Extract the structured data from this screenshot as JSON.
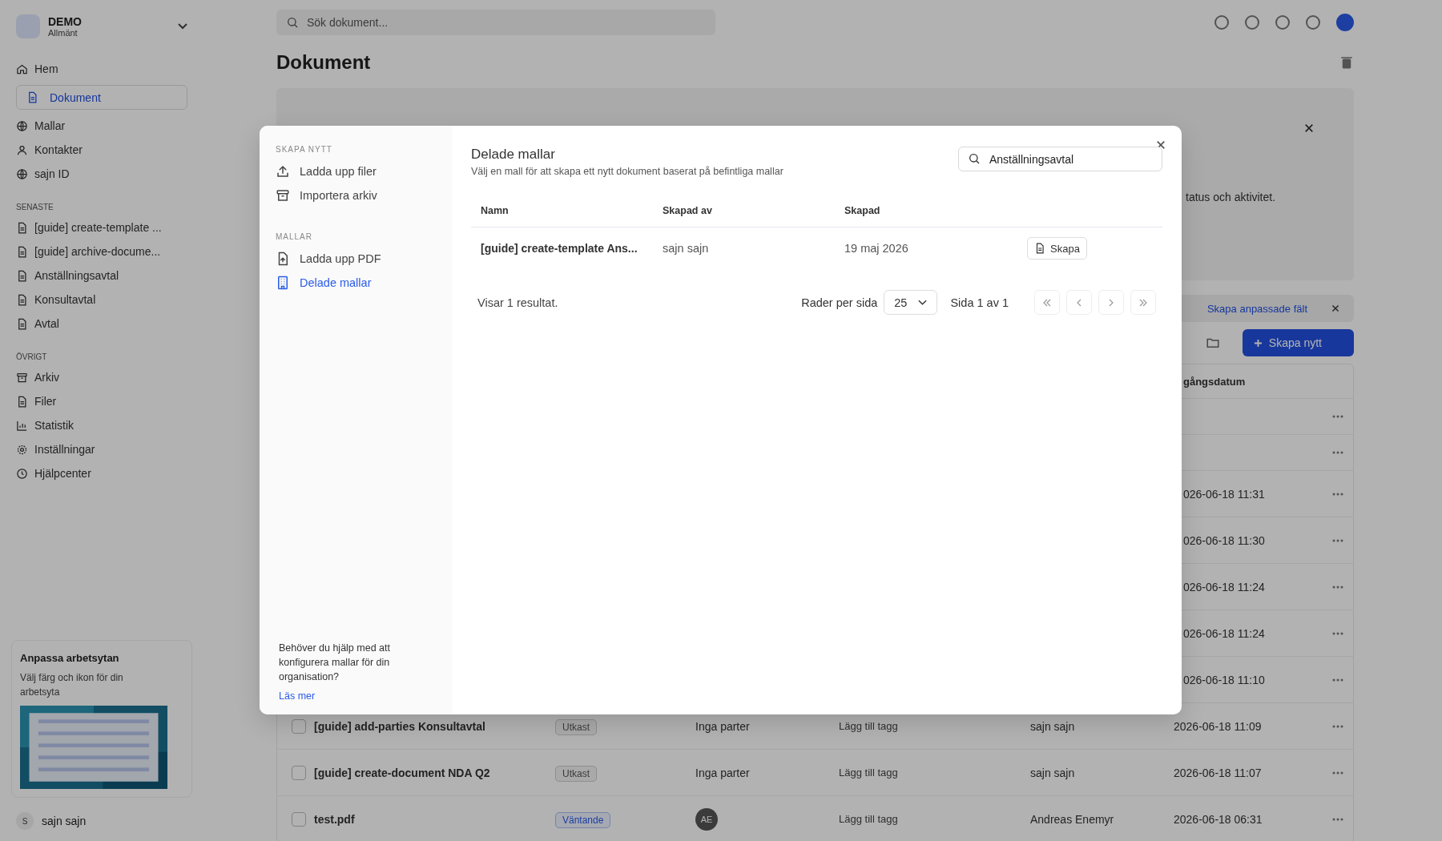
{
  "sidebar": {
    "org": {
      "name": "DEMO",
      "subtitle": "Allmänt"
    },
    "nav": [
      {
        "label": "Hem",
        "selected": false
      },
      {
        "label": "Dokument",
        "selected": true
      },
      {
        "label": "Mallar",
        "selected": false
      },
      {
        "label": "Kontakter",
        "selected": false
      },
      {
        "label": "sajn ID",
        "selected": false
      }
    ],
    "sections": [
      {
        "title": "SENASTE",
        "items": [
          "[guide] create-template ...",
          "[guide] archive-docume...",
          "Anställningsavtal",
          "Konsultavtal",
          "Avtal"
        ]
      },
      {
        "title": "ÖVRIGT",
        "items": [
          "Arkiv",
          "Filer",
          "Statistik",
          "Inställningar",
          "Hjälpcenter"
        ]
      }
    ],
    "card": {
      "title": "Anpassa arbetsytan",
      "text": "Välj färg och ikon för din arbetsyta"
    },
    "user": {
      "initial": "S",
      "name": "sajn sajn"
    }
  },
  "main": {
    "search": {
      "placeholder": "Sök dokument..."
    },
    "title": "Dokument",
    "banner_text": "tatus och aktivitet.",
    "custom_fields_link": "Skapa anpassade fält",
    "create_button": "Skapa nytt",
    "table": {
      "date_header": "gångsdatum",
      "rows": [
        {},
        {},
        {
          "date": "026-06-18 11:31"
        },
        {
          "date": "026-06-18 11:30"
        },
        {
          "date": "026-06-18 11:24"
        },
        {
          "date": "026-06-18 11:24"
        },
        {
          "date": "026-06-18 11:10"
        },
        {
          "name": "[guide] add-parties Konsultavtal",
          "checked": false,
          "status": "Utkast",
          "kind": "draft",
          "parties": "Inga parter",
          "tags": "Lägg till tagg",
          "owner": "sajn sajn",
          "date": "2026-06-18 11:09"
        },
        {
          "name": "[guide] create-document NDA Q2",
          "checked": false,
          "status": "Utkast",
          "kind": "draft",
          "parties": "Inga parter",
          "tags": "Lägg till tagg",
          "owner": "sajn sajn",
          "date": "2026-06-18 11:07"
        },
        {
          "name": "test.pdf",
          "checked": false,
          "status": "Väntande",
          "kind": "pending",
          "parties_avatar": "AE",
          "tags": "Lägg till tagg",
          "owner": "Andreas Enemyr",
          "date": "2026-06-18 06:31"
        }
      ]
    }
  },
  "modal": {
    "menu": [
      {
        "title": "SKAPA NYTT",
        "items": [
          {
            "label": "Ladda upp filer",
            "selected": false
          },
          {
            "label": "Importera arkiv",
            "selected": false
          }
        ]
      },
      {
        "title": "MALLAR",
        "items": [
          {
            "label": "Ladda upp PDF",
            "selected": false
          },
          {
            "label": "Delade mallar",
            "selected": true
          }
        ]
      }
    ],
    "help": {
      "text": "Behöver du hjälp med att konfigurera mallar för din organisation?",
      "link": "Läs mer"
    },
    "title": "Delade mallar",
    "subtitle": "Välj en mall för att skapa ett nytt dokument baserat på befintliga mallar",
    "search": {
      "value": "Anställningsavtal"
    },
    "columns": [
      "Namn",
      "Skapad av",
      "Skapad"
    ],
    "rows": [
      {
        "name": "[guide] create-template Ans...",
        "created_by": "sajn sajn",
        "created": "19 maj 2026",
        "action": "Skapa"
      }
    ],
    "result_text": "Visar 1 resultat.",
    "rows_per_page_label": "Rader per sida",
    "rows_per_page": "25",
    "page_text": "Sida 1 av 1"
  }
}
